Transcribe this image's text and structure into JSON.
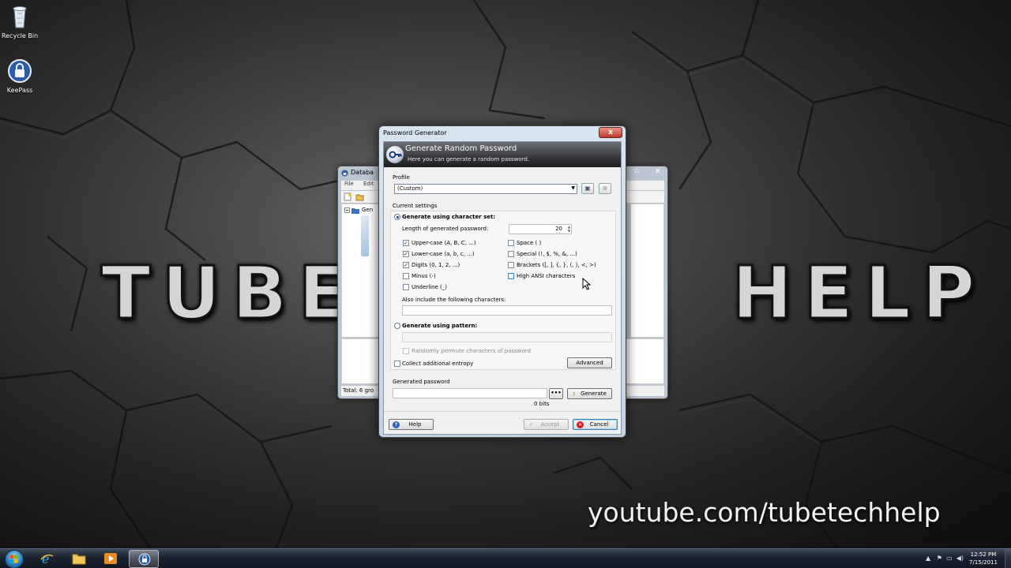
{
  "desktop": {
    "icons": [
      {
        "label": "Recycle Bin",
        "icon": "recycle-bin-icon"
      },
      {
        "label": "KeePass",
        "icon": "keepass-lock-icon"
      }
    ],
    "watermark_left": "TUBE",
    "watermark_right": "HELP",
    "url": "youtube.com/tubetechhelp"
  },
  "main_window": {
    "title": "Databa",
    "menu": [
      "File",
      "Edit"
    ],
    "tree_root": "Gen",
    "status": "Total: 6 gro"
  },
  "dialog": {
    "title": "Password Generator",
    "close_glyph": "x",
    "header_title": "Generate Random Password",
    "header_subtitle": "Here you can generate a random password.",
    "profile_label": "Profile",
    "profile_value": "(Custom)",
    "current_settings_label": "Current settings",
    "charset_option": "Generate using character set:",
    "length_label": "Length of generated password:",
    "length_value": "20",
    "checks_left": [
      {
        "label": "Upper-case (A, B, C, ...)",
        "checked": true
      },
      {
        "label": "Lower-case (a, b, c, ...)",
        "checked": true
      },
      {
        "label": "Digits (0, 1, 2, ...)",
        "checked": true
      },
      {
        "label": "Minus (-)",
        "checked": false
      },
      {
        "label": "Underline (_)",
        "checked": false
      }
    ],
    "checks_right": [
      {
        "label": "Space ( )",
        "checked": false
      },
      {
        "label": "Special (!, $, %, &, ...)",
        "checked": false
      },
      {
        "label": "Brackets ([, ], {, }, (, ), <, >)",
        "checked": false
      },
      {
        "label": "High ANSI characters",
        "checked": false
      }
    ],
    "also_include_label": "Also include the following characters:",
    "pattern_option": "Generate using pattern:",
    "permute_label": "Randomly permute characters of password",
    "entropy_label": "Collect additional entropy",
    "advanced_button": "Advanced",
    "generated_label": "Generated password",
    "dots_button": "•••",
    "generate_button": "Generate",
    "bits_label": "0 bits",
    "help_button": "Help",
    "accept_button": "Accept",
    "cancel_button": "Cancel"
  },
  "taskbar": {
    "items": [
      "ie-icon",
      "explorer-folder-icon",
      "media-player-icon",
      "keepass-icon"
    ],
    "time": "12:52 PM",
    "date": "7/15/2011"
  }
}
